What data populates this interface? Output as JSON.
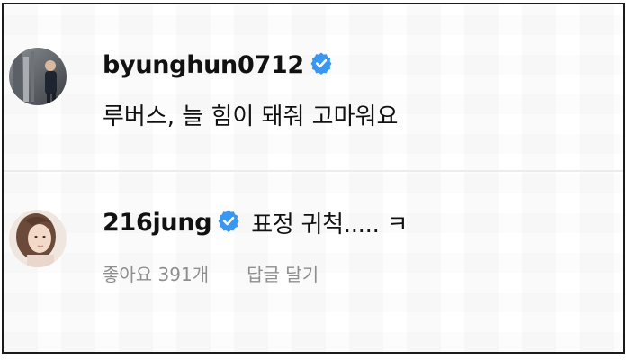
{
  "comments": [
    {
      "username": "byunghun0712",
      "verified": true,
      "text": "루버스, 늘 힘이 돼줘 고마워요"
    },
    {
      "username": "216jung",
      "verified": true,
      "text": "표정 귀척..... ㅋ",
      "likes_label": "좋아요 391개",
      "reply_label": "답글 달기"
    }
  ],
  "colors": {
    "verified_badge": "#3897f0",
    "meta_text": "#8e8e8e",
    "divider": "#ececec"
  },
  "icons": {
    "verified": "verified-badge-icon"
  }
}
